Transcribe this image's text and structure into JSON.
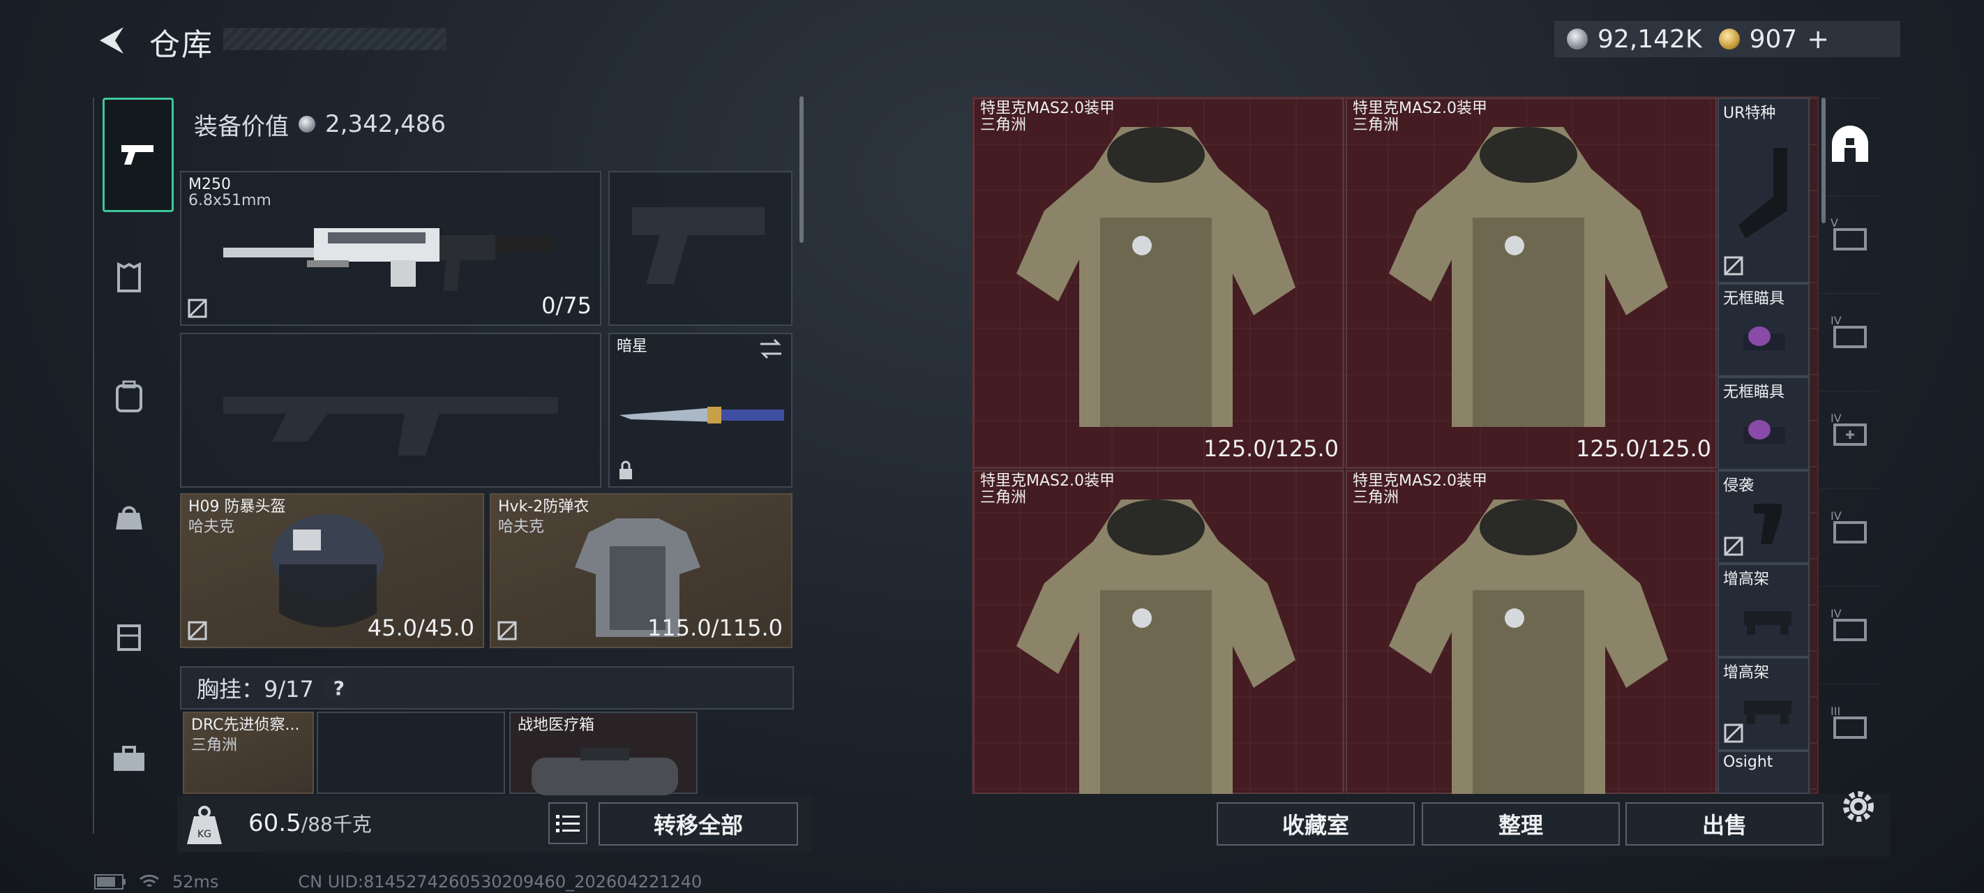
{
  "header": {
    "title": "仓库",
    "silver": "92,142K",
    "gold": "907",
    "gold_plus": "+"
  },
  "equipment": {
    "value_label": "装备价值",
    "value": "2,342,486",
    "primary": {
      "name": "M250",
      "caliber": "6.8x51mm",
      "ammo": "0/75"
    },
    "melee": {
      "name": "暗星"
    },
    "helmet": {
      "name": "H09 防暴头盔",
      "brand": "哈夫克",
      "durability": "45.0/45.0"
    },
    "armor": {
      "name": "Hvk-2防弹衣",
      "brand": "哈夫克",
      "durability": "115.0/115.0"
    },
    "chest": {
      "label": "胸挂：",
      "count": "9/17",
      "help": "?"
    },
    "chest_items": [
      {
        "name": "DRC先进侦察...",
        "brand": "三角洲"
      },
      {
        "name": "战地医疗箱",
        "brand": ""
      }
    ],
    "weight": "60.5",
    "weight_max": "/88千克",
    "transfer_all": "转移全部"
  },
  "stash": {
    "armors": [
      {
        "name": "特里克MAS2.0装甲",
        "brand": "三角洲",
        "durability": "125.0/125.0"
      },
      {
        "name": "特里克MAS2.0装甲",
        "brand": "三角洲",
        "durability": "125.0/125.0"
      },
      {
        "name": "特里克MAS2.0装甲",
        "brand": "三角洲",
        "durability": ""
      },
      {
        "name": "特里克MAS2.0装甲",
        "brand": "三角洲",
        "durability": ""
      }
    ],
    "attachments": [
      "UR特种",
      "无框瞄具",
      "无框瞄具",
      "侵袭",
      "增高架",
      "增高架",
      "Osight"
    ]
  },
  "actions": {
    "collection": "收藏室",
    "organize": "整理",
    "sell": "出售"
  },
  "status": {
    "ping": "52ms",
    "uid": "CN UID:8145274260530209460_202604221240"
  }
}
